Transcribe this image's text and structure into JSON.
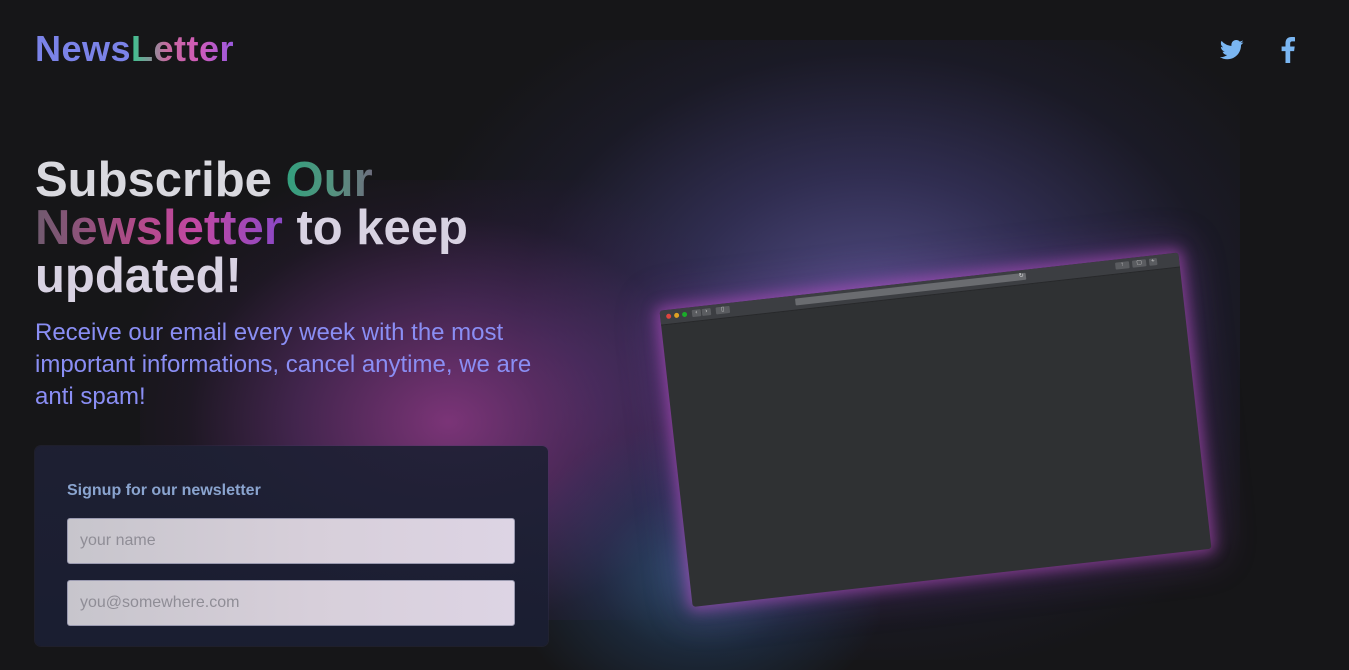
{
  "brand": {
    "logo_part1": "News",
    "logo_part2": "Letter",
    "accent_blue": "#7b83e8",
    "gradient": [
      "#38c68e",
      "#c66aa0",
      "#d05bb8",
      "#9a5ae0"
    ]
  },
  "social": {
    "twitter_icon": "twitter-icon",
    "facebook_icon": "facebook-icon",
    "twitter_color": "#7ab6f2",
    "facebook_color": "#7ab6f2"
  },
  "hero": {
    "line_a": "Subscribe ",
    "line_b": "Our",
    "line_c": "Newsletter",
    "line_d": " to keep updated!"
  },
  "subtitle": "Receive our email every week with the most important informations, cancel anytime, we are anti spam!",
  "signup": {
    "title": "Signup for our newsletter",
    "name_placeholder": "your name",
    "email_placeholder": "you@somewhere.com"
  }
}
